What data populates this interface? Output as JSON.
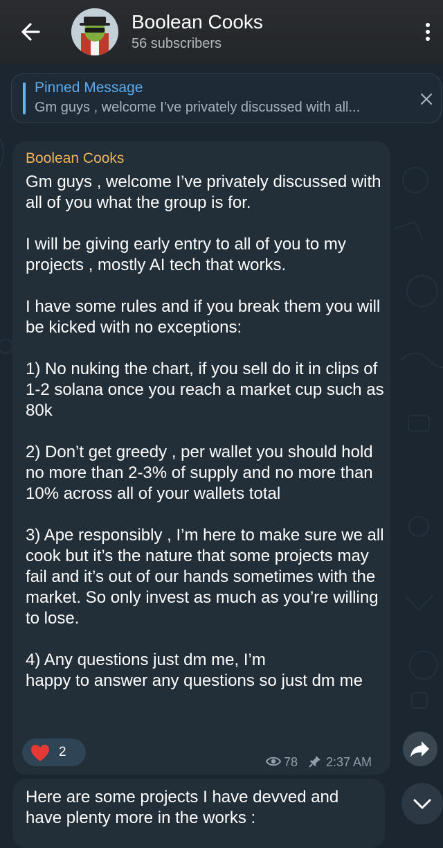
{
  "header": {
    "title": "Boolean Cooks",
    "subtitle": "56 subscribers",
    "back_icon": "arrow-left-icon",
    "menu_icon": "more-vertical-icon"
  },
  "pinned": {
    "title": "Pinned Message",
    "text": "Gm guys , welcome I’ve privately discussed with all...",
    "close_icon": "close-icon"
  },
  "message": {
    "sender": "Boolean Cooks",
    "body": "Gm guys , welcome I’ve privately discussed with all of you what the group is for.\n\nI will be giving early entry to all of you to my projects , mostly AI tech that works.\n\nI have some rules and if you break them you will be kicked with no exceptions:\n\n1) No nuking the chart, if you sell do it in clips of 1-2 solana once you reach a market cup such as 80k\n\n2) Don’t get greedy , per wallet you should hold no more than 2-3% of supply and no more than 10% across all of your wallets total\n\n3) Ape responsibly , I’m here to make sure we all cook but it’s the nature that some projects may fail and it’s out of our hands sometimes with the market. So only invest as much as you’re willing to lose.\n\n4) Any questions just dm me, I’m\nhappy to answer any questions so just dm me",
    "reaction": {
      "icon": "heart-icon",
      "count": "2"
    },
    "views": "78",
    "time": "2:37 AM"
  },
  "message2": {
    "body": "Here are some projects I have devved and have plenty more in the works :"
  },
  "colors": {
    "background": "#1b2631",
    "bubble": "#222e38",
    "sender": "#f0b45c",
    "accent": "#5ea8e8",
    "heart": "#e53935"
  }
}
